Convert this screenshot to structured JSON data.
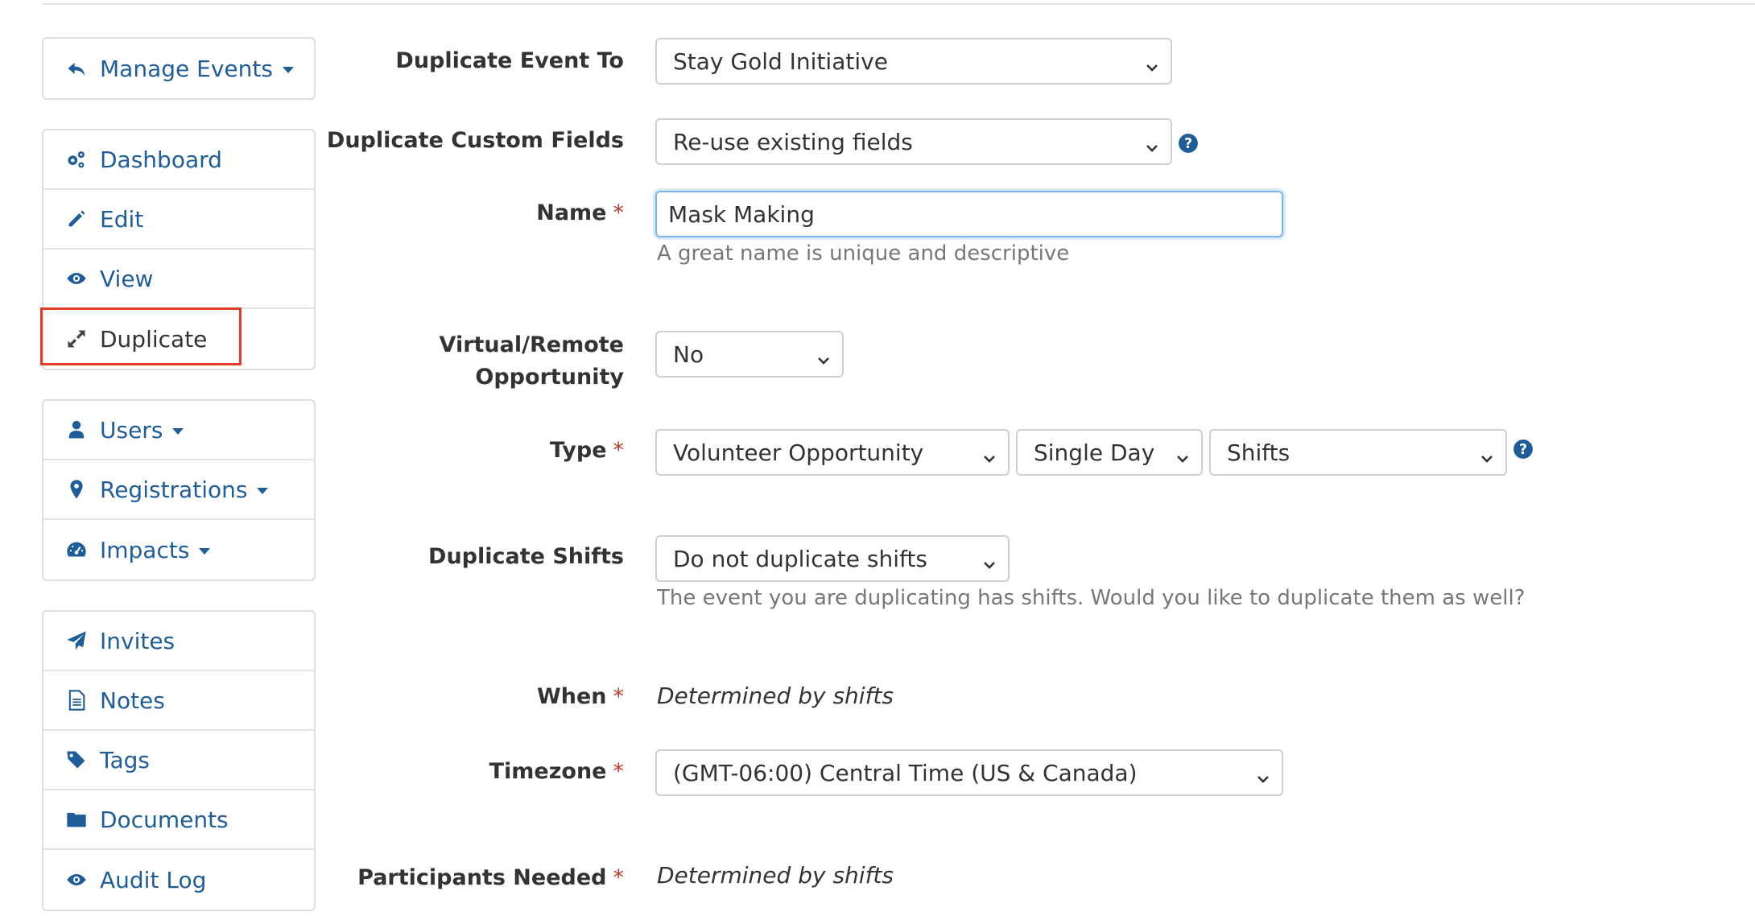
{
  "sidebar": {
    "manage_events": "Manage Events",
    "group1": [
      "Dashboard",
      "Edit",
      "View",
      "Duplicate"
    ],
    "group2": [
      "Users",
      "Registrations",
      "Impacts"
    ],
    "group3": [
      "Invites",
      "Notes",
      "Tags",
      "Documents",
      "Audit Log"
    ]
  },
  "form": {
    "duplicate_event_to": {
      "label": "Duplicate Event To",
      "value": "Stay Gold Initiative"
    },
    "duplicate_custom_fields": {
      "label": "Duplicate Custom Fields",
      "value": "Re-use existing fields"
    },
    "name": {
      "label": "Name",
      "value": "Mask Making",
      "help": "A great name is unique and descriptive"
    },
    "virtual": {
      "label_line1": "Virtual/Remote",
      "label_line2": "Opportunity",
      "value": "No"
    },
    "type": {
      "label": "Type",
      "value1": "Volunteer Opportunity",
      "value2": "Single Day",
      "value3": "Shifts"
    },
    "duplicate_shifts": {
      "label": "Duplicate Shifts",
      "value": "Do not duplicate shifts",
      "help": "The event you are duplicating has shifts. Would you like to duplicate them as well?"
    },
    "when": {
      "label": "When",
      "value": "Determined by shifts"
    },
    "timezone": {
      "label": "Timezone",
      "value": "(GMT-06:00) Central Time (US & Canada)"
    },
    "participants_needed": {
      "label": "Participants Needed",
      "value": "Determined by shifts"
    },
    "required_mark": "*"
  },
  "colors": {
    "link": "#1f5d9a",
    "required": "#c0392b",
    "highlight": "#e23b26"
  }
}
